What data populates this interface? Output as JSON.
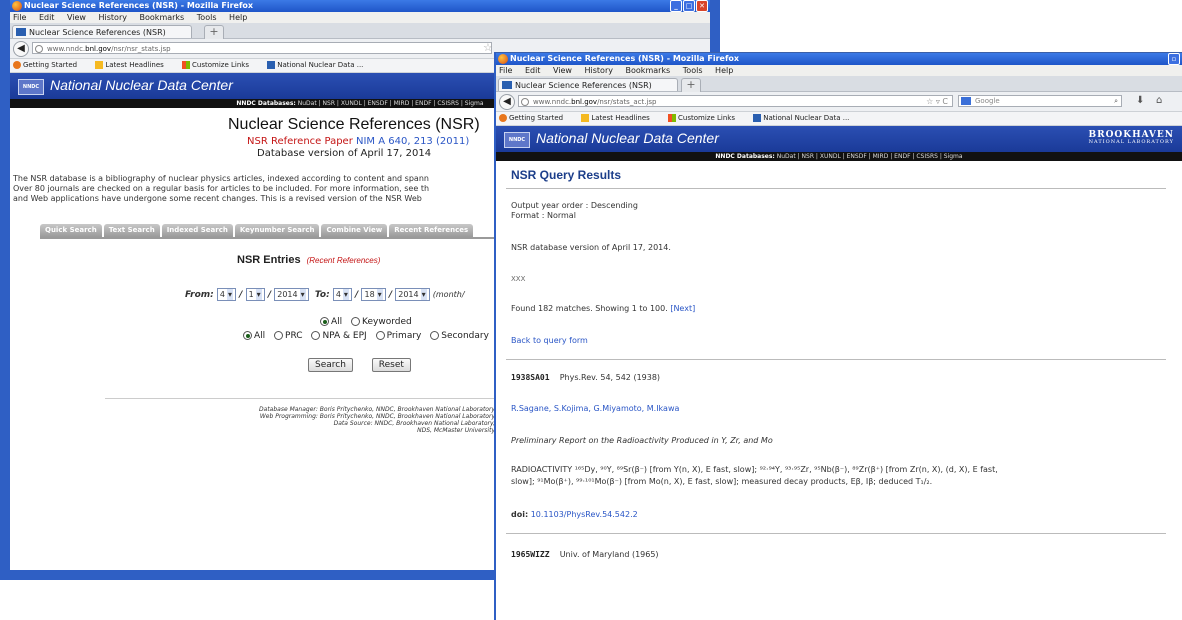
{
  "win1": {
    "title": "Nuclear Science References (NSR) - Mozilla Firefox",
    "menu": [
      "File",
      "Edit",
      "View",
      "History",
      "Bookmarks",
      "Tools",
      "Help"
    ],
    "tab_label": "Nuclear Science References (NSR)",
    "url_prefix": "www.nndc.",
    "url_host": "bnl.gov",
    "url_path": "/nsr/nsr_stats.jsp",
    "bookmarks": [
      "Getting Started",
      "Latest Headlines",
      "Customize Links",
      "National Nuclear Data ..."
    ],
    "header_title": "National Nuclear Data Center",
    "logo": "NNDC",
    "db_label": "NNDC Databases:",
    "db_links": "NuDat | NSR | XUNDL | ENSDF | MIRD | ENDF | CSISRS | Sigma",
    "page_title": "Nuclear Science References (NSR)",
    "ref_paper_label": "NSR Reference Paper",
    "ref_paper_cite": "NIM A 640, 213 (2011)",
    "db_version": "Database version of April 17, 2014",
    "intro_line1": "The NSR database is a bibliography of nuclear physics articles, indexed according to content and spann",
    "intro_line2": "Over 80 journals are checked on a regular basis for articles to be included. For more information, see th",
    "intro_line3": "and Web applications have undergone some recent changes. This is a revised version of the NSR Web",
    "tabs": [
      "Quick Search",
      "Text Search",
      "Indexed Search",
      "Keynumber Search",
      "Combine View",
      "Recent References"
    ],
    "entries_title": "NSR Entries",
    "recent_refs": "(Recent References)",
    "from_label": "From:",
    "to_label": "To:",
    "from_month": "4",
    "from_day": "1",
    "from_year": "2014",
    "to_month": "4",
    "to_day": "18",
    "to_year": "2014",
    "format_hint": "(month/",
    "radio_all": "All",
    "radio_keyworded": "Keyworded",
    "radio2_all": "All",
    "radio_prc": "PRC",
    "radio_npa": "NPA & EPJ",
    "radio_primary": "Primary",
    "radio_secondary": "Secondary",
    "search_btn": "Search",
    "reset_btn": "Reset",
    "credits_l1": "Database Manager: Boris Pritychenko, NNDC, Brookhaven National Laboratory",
    "credits_l2": "Web Programming: Boris Pritychenko, NNDC, Brookhaven National Laboratory",
    "credits_l3": "Data Source: NNDC, Brookhaven National Laboratory,",
    "credits_l4": "NDS, McMaster University"
  },
  "win2": {
    "title": "Nuclear Science References (NSR) - Mozilla Firefox",
    "menu": [
      "File",
      "Edit",
      "View",
      "History",
      "Bookmarks",
      "Tools",
      "Help"
    ],
    "tab_label": "Nuclear Science References (NSR)",
    "url_prefix": "www.nndc.",
    "url_host": "bnl.gov",
    "url_path": "/nsr/stats_act.jsp",
    "search_engine": "Google",
    "bookmarks": [
      "Getting Started",
      "Latest Headlines",
      "Customize Links",
      "National Nuclear Data ..."
    ],
    "header_title": "National Nuclear Data Center",
    "logo": "NNDC",
    "bnl_1": "BROOKHAVEN",
    "bnl_2": "NATIONAL LABORATORY",
    "db_label": "NNDC Databases:",
    "db_links": "NuDat | NSR | XUNDL | ENSDF | MIRD | ENDF | CSISRS | Sigma",
    "results_title": "NSR Query Results",
    "order": "Output year order : Descending",
    "format": "Format : Normal",
    "version": "NSR database version of April 17, 2014.",
    "xxx": "XXX",
    "found": "Found 182 matches.   Showing 1 to 100.",
    "next": "[Next]",
    "back": "Back to query form",
    "e1_key": "1938SA01",
    "e1_ref": "Phys.Rev. 54, 542 (1938)",
    "e1_authors": "R.Sagane, S.Kojima, G.Miyamoto, M.Ikawa",
    "e1_title": "Preliminary Report on the Radioactivity Produced in Y, Zr, and Mo",
    "e1_kw1": "RADIOACTIVITY ¹⁶⁵Dy, ⁹⁰Y, ⁸⁹Sr(β⁻) [from Y(n, X), E fast, slow]; ⁹²·⁹⁴Y, ⁹³·⁹⁵Zr, ⁹⁵Nb(β⁻), ⁸⁹Zr(β⁺) [from Zr(n, X), (d, X), E fast,",
    "e1_kw2": "slow]; ⁹¹Mo(β⁺), ⁹⁹·¹⁰¹Mo(β⁻) [from Mo(n, X), E fast, slow]; measured decay products, Eβ, Iβ; deduced T₁/₂.",
    "doi_label": "doi:",
    "doi": "10.1103/PhysRev.54.542.2",
    "e2_key": "1965WIZZ",
    "e2_ref": "Univ. of Maryland (1965)"
  }
}
